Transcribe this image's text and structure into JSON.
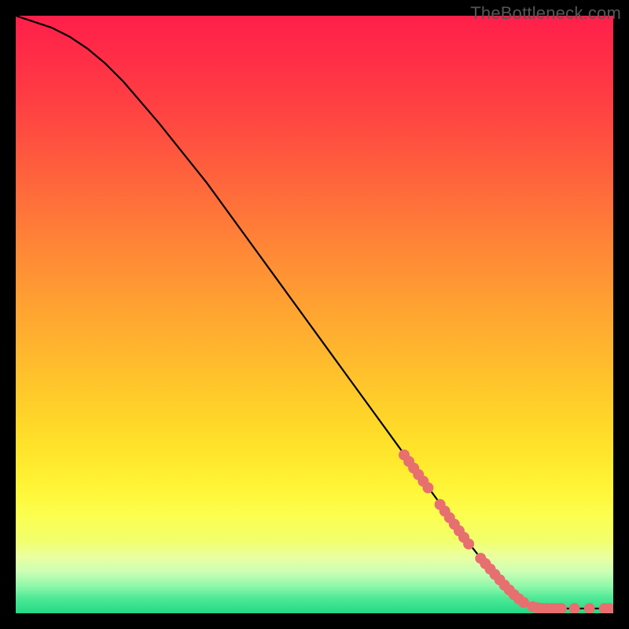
{
  "watermark": "TheBottleneck.com",
  "chart_data": {
    "type": "line",
    "title": "",
    "xlabel": "",
    "ylabel": "",
    "xlim": [
      0,
      100
    ],
    "ylim": [
      0,
      100
    ],
    "curve": [
      {
        "x": 0,
        "y": 100
      },
      {
        "x": 3,
        "y": 99
      },
      {
        "x": 6,
        "y": 98
      },
      {
        "x": 9,
        "y": 96.5
      },
      {
        "x": 12,
        "y": 94.5
      },
      {
        "x": 15,
        "y": 92
      },
      {
        "x": 18,
        "y": 89
      },
      {
        "x": 21,
        "y": 85.5
      },
      {
        "x": 24,
        "y": 82
      },
      {
        "x": 28,
        "y": 77
      },
      {
        "x": 32,
        "y": 72
      },
      {
        "x": 36,
        "y": 66.5
      },
      {
        "x": 40,
        "y": 61
      },
      {
        "x": 44,
        "y": 55.5
      },
      {
        "x": 48,
        "y": 50
      },
      {
        "x": 52,
        "y": 44.5
      },
      {
        "x": 56,
        "y": 39
      },
      {
        "x": 60,
        "y": 33.5
      },
      {
        "x": 64,
        "y": 28
      },
      {
        "x": 68,
        "y": 22.5
      },
      {
        "x": 72,
        "y": 17
      },
      {
        "x": 76,
        "y": 11.5
      },
      {
        "x": 80,
        "y": 6.5
      },
      {
        "x": 83,
        "y": 3
      },
      {
        "x": 86,
        "y": 1.3
      },
      {
        "x": 88,
        "y": 0.8
      },
      {
        "x": 100,
        "y": 0.8
      }
    ],
    "markers": [
      {
        "x": 65.0,
        "y": 26.5
      },
      {
        "x": 65.8,
        "y": 25.4
      },
      {
        "x": 66.6,
        "y": 24.3
      },
      {
        "x": 67.4,
        "y": 23.2
      },
      {
        "x": 68.2,
        "y": 22.1
      },
      {
        "x": 69.0,
        "y": 21.0
      },
      {
        "x": 71.0,
        "y": 18.2
      },
      {
        "x": 71.8,
        "y": 17.1
      },
      {
        "x": 72.6,
        "y": 16.0
      },
      {
        "x": 73.4,
        "y": 14.9
      },
      {
        "x": 74.2,
        "y": 13.8
      },
      {
        "x": 75.0,
        "y": 12.7
      },
      {
        "x": 75.8,
        "y": 11.6
      },
      {
        "x": 77.8,
        "y": 9.2
      },
      {
        "x": 78.6,
        "y": 8.3
      },
      {
        "x": 79.4,
        "y": 7.4
      },
      {
        "x": 80.2,
        "y": 6.5
      },
      {
        "x": 81.0,
        "y": 5.6
      },
      {
        "x": 81.8,
        "y": 4.7
      },
      {
        "x": 82.6,
        "y": 3.9
      },
      {
        "x": 83.4,
        "y": 3.1
      },
      {
        "x": 84.2,
        "y": 2.4
      },
      {
        "x": 85.0,
        "y": 1.8
      },
      {
        "x": 86.5,
        "y": 1.1
      },
      {
        "x": 87.3,
        "y": 0.9
      },
      {
        "x": 88.1,
        "y": 0.8
      },
      {
        "x": 88.9,
        "y": 0.8
      },
      {
        "x": 89.7,
        "y": 0.8
      },
      {
        "x": 90.5,
        "y": 0.8
      },
      {
        "x": 91.3,
        "y": 0.8
      },
      {
        "x": 93.5,
        "y": 0.8
      },
      {
        "x": 96.0,
        "y": 0.8
      },
      {
        "x": 98.5,
        "y": 0.8
      },
      {
        "x": 99.3,
        "y": 0.8
      }
    ],
    "marker_color": "#e76f6f",
    "line_color": "#000000",
    "gradient_stops": [
      {
        "offset": 0.0,
        "color": "#ff1f4a"
      },
      {
        "offset": 0.04,
        "color": "#ff2748"
      },
      {
        "offset": 0.08,
        "color": "#ff3046"
      },
      {
        "offset": 0.12,
        "color": "#ff3944"
      },
      {
        "offset": 0.16,
        "color": "#ff4342"
      },
      {
        "offset": 0.2,
        "color": "#ff4e40"
      },
      {
        "offset": 0.24,
        "color": "#ff5a3e"
      },
      {
        "offset": 0.28,
        "color": "#ff663c"
      },
      {
        "offset": 0.32,
        "color": "#ff723a"
      },
      {
        "offset": 0.36,
        "color": "#ff7e38"
      },
      {
        "offset": 0.4,
        "color": "#ff8a36"
      },
      {
        "offset": 0.44,
        "color": "#ff9534"
      },
      {
        "offset": 0.48,
        "color": "#ffa032"
      },
      {
        "offset": 0.52,
        "color": "#ffab30"
      },
      {
        "offset": 0.56,
        "color": "#ffb62e"
      },
      {
        "offset": 0.6,
        "color": "#ffc12c"
      },
      {
        "offset": 0.64,
        "color": "#ffcc2a"
      },
      {
        "offset": 0.68,
        "color": "#ffd728"
      },
      {
        "offset": 0.72,
        "color": "#ffe22a"
      },
      {
        "offset": 0.76,
        "color": "#ffed30"
      },
      {
        "offset": 0.8,
        "color": "#fff73a"
      },
      {
        "offset": 0.84,
        "color": "#fbff52"
      },
      {
        "offset": 0.88,
        "color": "#f2ff6e"
      },
      {
        "offset": 0.905,
        "color": "#eaffa0"
      },
      {
        "offset": 0.93,
        "color": "#ccffb4"
      },
      {
        "offset": 0.955,
        "color": "#8ef7aa"
      },
      {
        "offset": 0.975,
        "color": "#4de996"
      },
      {
        "offset": 1.0,
        "color": "#24d884"
      }
    ]
  }
}
